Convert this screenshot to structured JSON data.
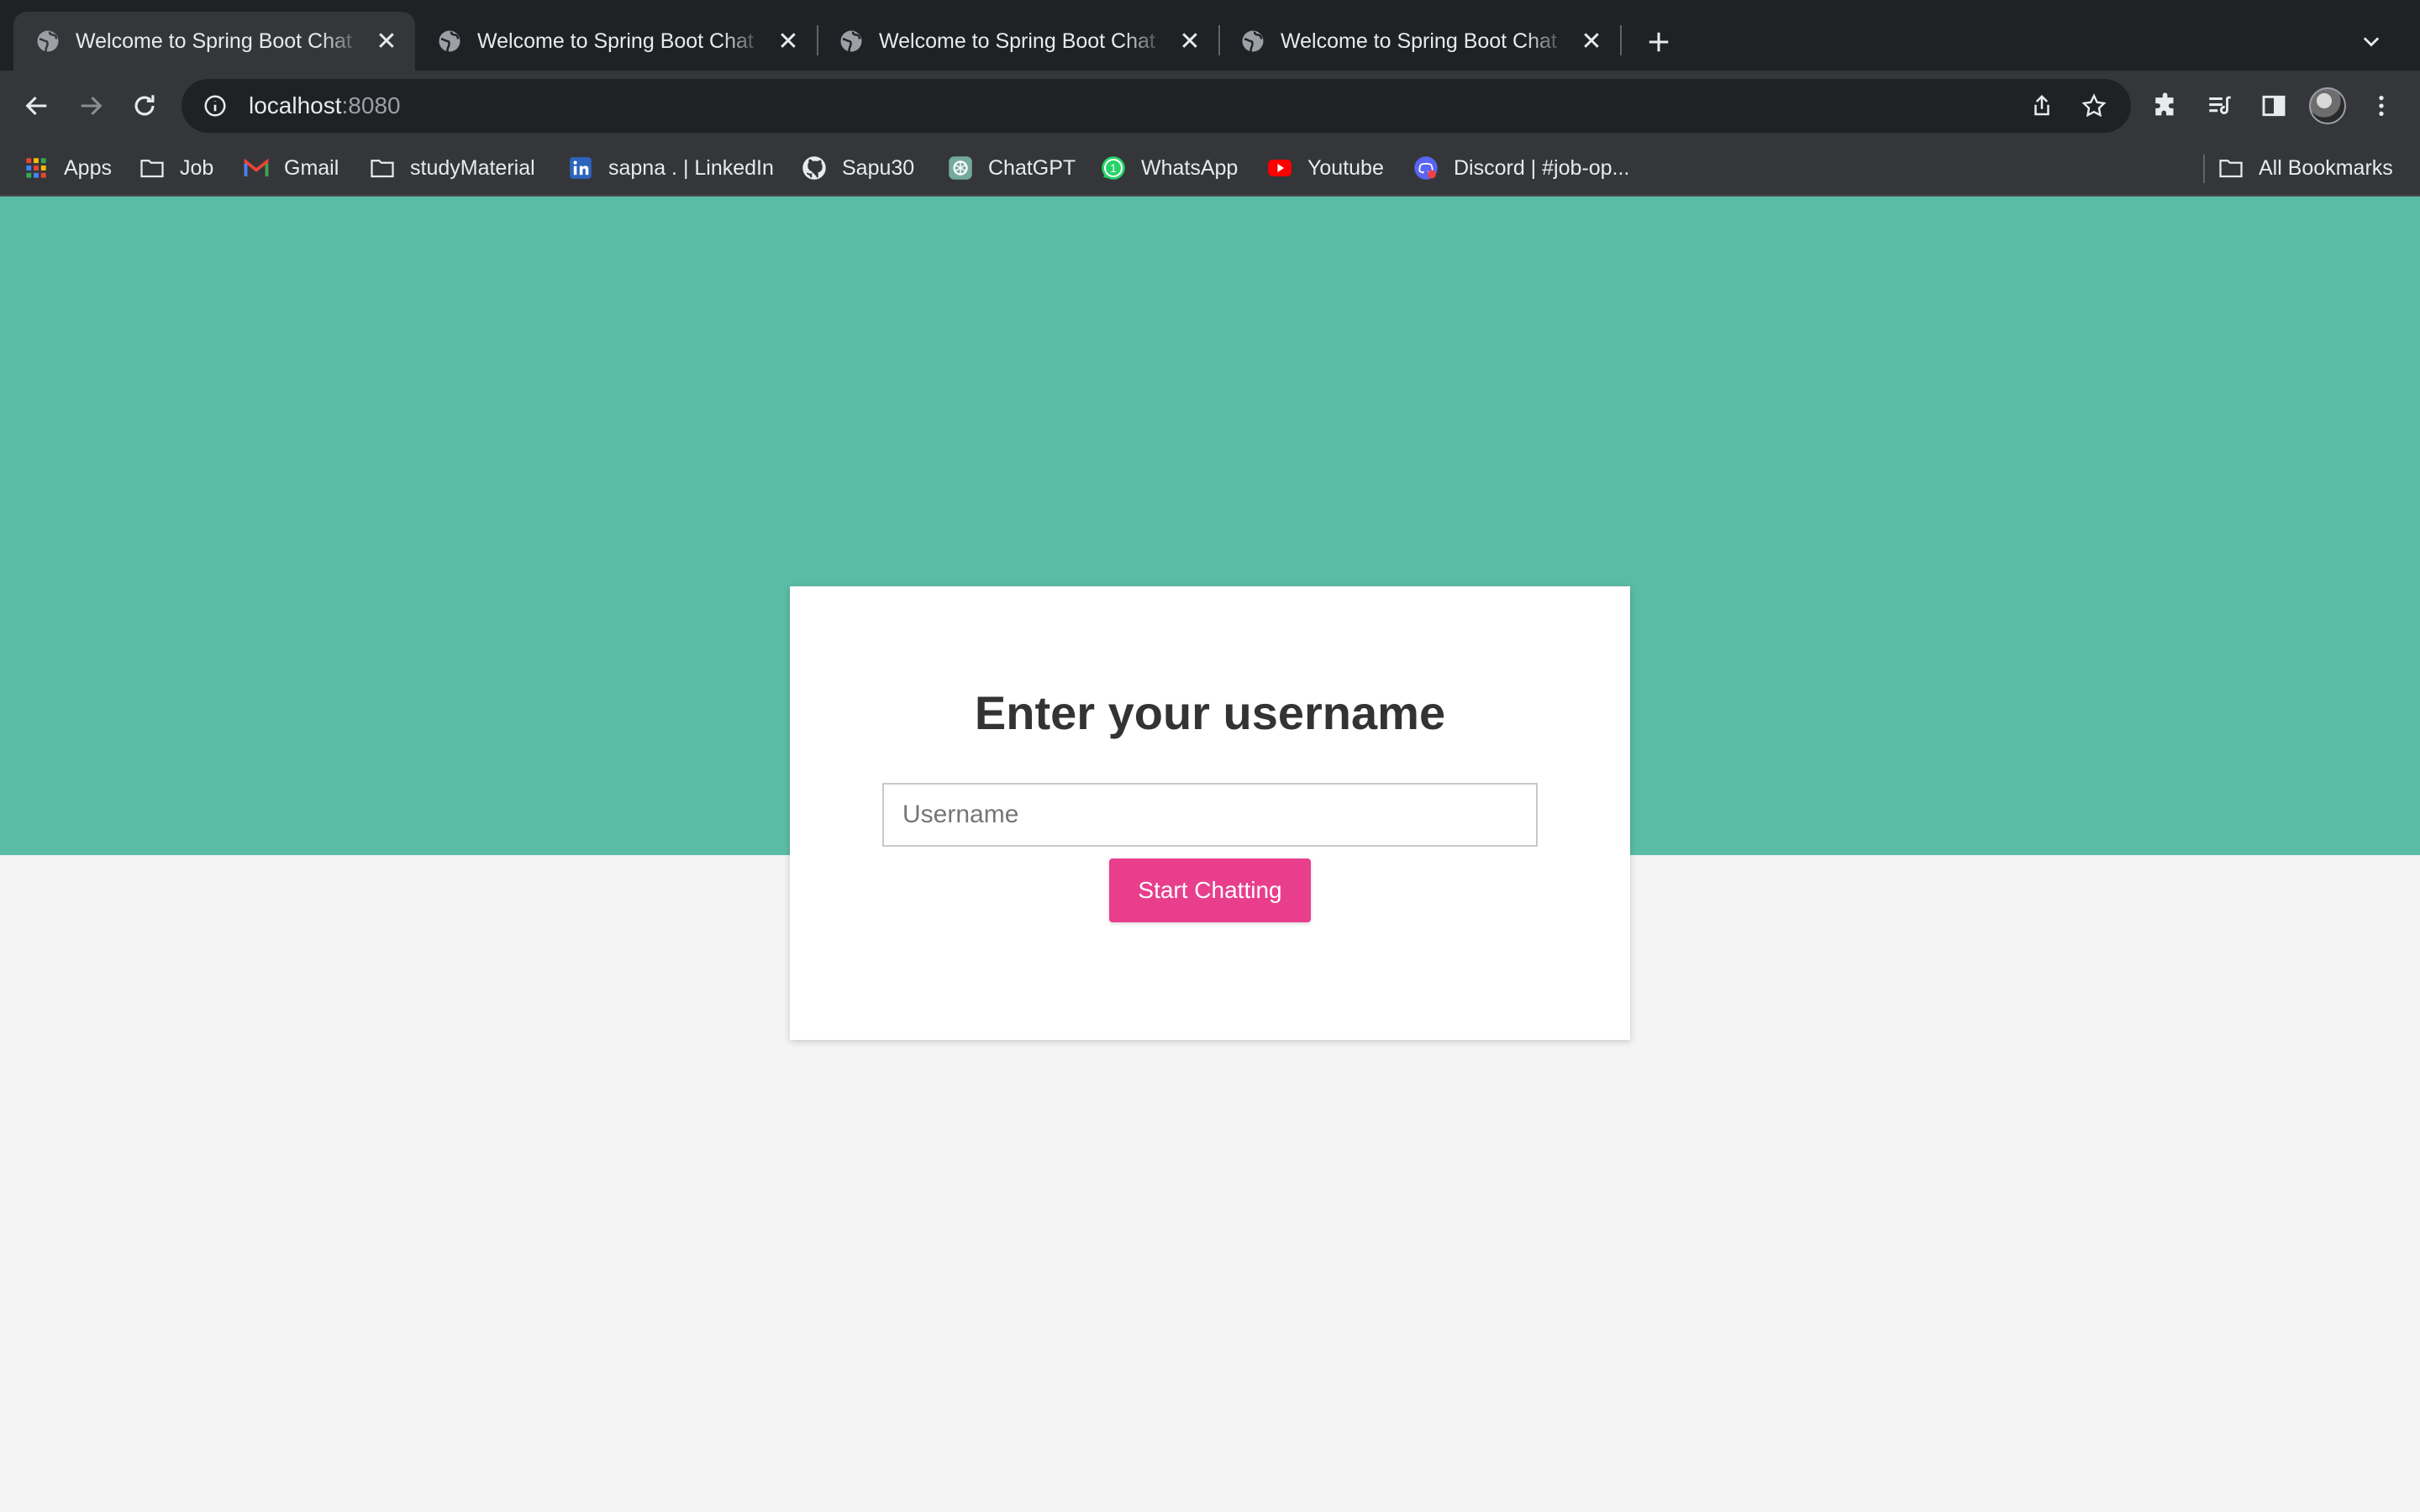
{
  "browser": {
    "tabs": [
      {
        "title": "Welcome to Spring Boot Chat",
        "active": true
      },
      {
        "title": "Welcome to Spring Boot Chat",
        "active": false
      },
      {
        "title": "Welcome to Spring Boot Chat",
        "active": false
      },
      {
        "title": "Welcome to Spring Boot Chat",
        "active": false
      }
    ],
    "address": {
      "host": "localhost",
      "port": ":8080"
    },
    "bookmarks": [
      {
        "label": "Apps",
        "icon": "apps-grid-icon"
      },
      {
        "label": "Job",
        "icon": "folder-icon"
      },
      {
        "label": "Gmail",
        "icon": "gmail-icon"
      },
      {
        "label": "studyMaterial",
        "icon": "folder-icon"
      },
      {
        "label": "sapna . | LinkedIn",
        "icon": "linkedin-icon"
      },
      {
        "label": "Sapu30",
        "icon": "github-icon"
      },
      {
        "label": "ChatGPT",
        "icon": "chatgpt-icon"
      },
      {
        "label": "WhatsApp",
        "icon": "whatsapp-icon"
      },
      {
        "label": "Youtube",
        "icon": "youtube-icon"
      },
      {
        "label": "Discord | #job-op...",
        "icon": "discord-icon"
      }
    ],
    "all_bookmarks": "All Bookmarks",
    "whatsapp_badge": "1"
  },
  "page": {
    "heading": "Enter your username",
    "username_placeholder": "Username",
    "button_label": "Start Chatting",
    "colors": {
      "hero": "#5bbca6",
      "background": "#f4f4f4",
      "button": "#e83e8c"
    }
  }
}
